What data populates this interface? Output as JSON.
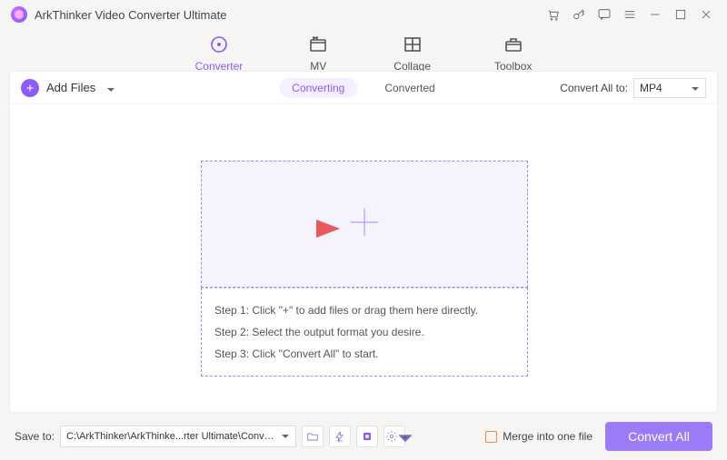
{
  "app": {
    "title": "ArkThinker Video Converter Ultimate"
  },
  "tabs": {
    "converter": "Converter",
    "mv": "MV",
    "collage": "Collage",
    "toolbox": "Toolbox"
  },
  "toolbar": {
    "add_files": "Add Files",
    "converting": "Converting",
    "converted": "Converted",
    "convert_all_to": "Convert All to:",
    "format": "MP4"
  },
  "steps": {
    "s1": "Step 1: Click \"+\" to add files or drag them here directly.",
    "s2": "Step 2: Select the output format you desire.",
    "s3": "Step 3: Click \"Convert All\" to start."
  },
  "bottom": {
    "save_to": "Save to:",
    "path": "C:\\ArkThinker\\ArkThinke...rter Ultimate\\Converted",
    "merge": "Merge into one file",
    "convert_all": "Convert All"
  }
}
